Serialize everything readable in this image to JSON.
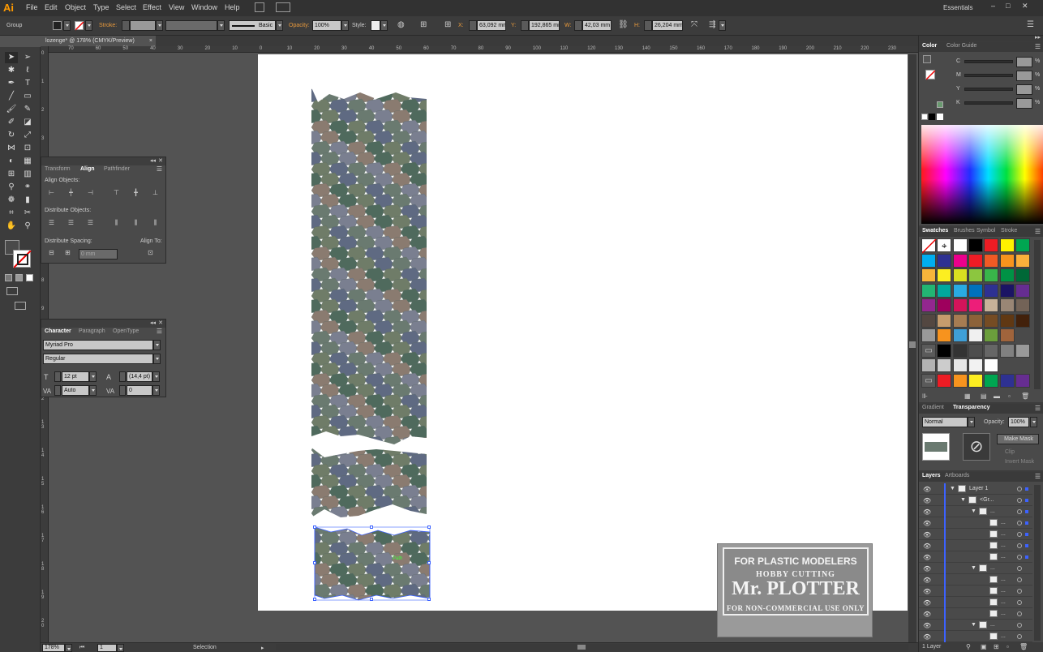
{
  "menubar": {
    "logo": "Ai",
    "items": [
      "File",
      "Edit",
      "Object",
      "Type",
      "Select",
      "Effect",
      "View",
      "Window",
      "Help"
    ],
    "workspace": "Essentials"
  },
  "control": {
    "selection_type": "Group",
    "stroke_label": "Stroke:",
    "brush": "Basic",
    "opacity_label": "Opacity:",
    "opacity": "100%",
    "style_label": "Style:",
    "x_label": "X:",
    "x": "63,092 mm",
    "y_label": "Y:",
    "y": "192,865 mm",
    "w_label": "W:",
    "w": "42,03 mm",
    "h_label": "H:",
    "h": "26,204 mm"
  },
  "document": {
    "tab": "lozenge* @ 178% (CMYK/Preview)",
    "close": "×"
  },
  "ruler": {
    "top_ticks": [
      "70",
      "60",
      "50",
      "40",
      "30",
      "20",
      "10",
      "0",
      "10",
      "20",
      "30",
      "40",
      "50",
      "60",
      "70",
      "80",
      "90",
      "100",
      "110",
      "120",
      "130",
      "140",
      "150",
      "160",
      "170",
      "180",
      "190",
      "200",
      "210",
      "220",
      "230"
    ],
    "left_ticks": [
      "0",
      "1",
      "2",
      "3",
      "4",
      "5",
      "6",
      "7",
      "8",
      "9",
      "10",
      "11",
      "12",
      "13",
      "14",
      "15",
      "16",
      "17",
      "18",
      "19",
      "20"
    ]
  },
  "align_panel": {
    "tabs": [
      "Transform",
      "Align",
      "Pathfinder"
    ],
    "align_objects": "Align Objects:",
    "distribute_objects": "Distribute Objects:",
    "distribute_spacing": "Distribute Spacing:",
    "align_to": "Align To:",
    "spacing_value": "0 mm"
  },
  "character_panel": {
    "tabs": [
      "Character",
      "Paragraph",
      "OpenType"
    ],
    "font": "Myriad Pro",
    "style": "Regular",
    "size": "12 pt",
    "leading": "(14,4 pt)",
    "kerning": "Auto",
    "tracking": "0"
  },
  "color_panel": {
    "tabs": [
      "Color",
      "Color Guide"
    ],
    "channels": [
      {
        "label": "C",
        "unit": "%"
      },
      {
        "label": "M",
        "unit": "%"
      },
      {
        "label": "Y",
        "unit": "%"
      },
      {
        "label": "K",
        "unit": "%"
      }
    ]
  },
  "swatches_panel": {
    "tabs": [
      "Swatches",
      "Brushes",
      "Symbol",
      "Stroke"
    ],
    "rows": [
      [
        "none",
        "register",
        "#ffffff",
        "#000000",
        "#ed1c24",
        "#fff200",
        "#00a651"
      ],
      [
        "#00aeef",
        "#2e3192",
        "#ec008c",
        "#ee1c25",
        "#f15a24",
        "#f7941d",
        "#fbb03b"
      ],
      [
        "#f7b53b",
        "#fcee21",
        "#d9e021",
        "#8cc63f",
        "#39b54a",
        "#009245",
        "#006837"
      ],
      [
        "#22b573",
        "#00a99d",
        "#29abe2",
        "#0071bc",
        "#2e3192",
        "#1b1464",
        "#662d91"
      ],
      [
        "#93278f",
        "#9e005d",
        "#d4145a",
        "#ed1e79",
        "#c7b299",
        "#998675",
        "#736357"
      ],
      [
        "#534741",
        "#c69c6d",
        "#a67c52",
        "#8c6239",
        "#754c24",
        "#603813",
        "#42210b"
      ],
      [
        "#999999",
        "#f7931e",
        "#3f9fd6",
        "#f0f0f0",
        "#6b9e3c",
        "#a0643c",
        ""
      ],
      [
        "folder",
        "#000000",
        "#333333",
        "#4d4d4d",
        "#666666",
        "#808080",
        "#999999"
      ],
      [
        "#b3b3b3",
        "#cccccc",
        "#e6e6e6",
        "#f2f2f2",
        "#ffffff",
        "",
        ""
      ],
      [
        "folder",
        "#ed1c24",
        "#f7931e",
        "#fcee21",
        "#00a651",
        "#2e3192",
        "#662d91"
      ]
    ]
  },
  "transparency_panel": {
    "tabs": [
      "Gradient",
      "Transparency"
    ],
    "blend_mode": "Normal",
    "opacity_label": "Opacity:",
    "opacity": "100%",
    "make_mask": "Make Mask",
    "clip": "Clip",
    "invert_mask": "Invert Mask"
  },
  "layers_panel": {
    "tabs": [
      "Layers",
      "Artboards"
    ],
    "rows": [
      {
        "name": "Layer 1",
        "indent": 0
      },
      {
        "name": "<Gr...",
        "indent": 1
      },
      {
        "name": "...",
        "indent": 2
      },
      {
        "name": "...",
        "indent": 3
      },
      {
        "name": "...",
        "indent": 3
      },
      {
        "name": "...",
        "indent": 3
      },
      {
        "name": "...",
        "indent": 3
      },
      {
        "name": "...",
        "indent": 2
      },
      {
        "name": "...",
        "indent": 3
      },
      {
        "name": "...",
        "indent": 3
      },
      {
        "name": "...",
        "indent": 3
      },
      {
        "name": "...",
        "indent": 3
      },
      {
        "name": "...",
        "indent": 2
      },
      {
        "name": "...",
        "indent": 3
      }
    ],
    "count": "1 Layer"
  },
  "status": {
    "zoom": "178%",
    "artboard": "1",
    "tool": "Selection"
  },
  "canvas": {
    "selection_label": "Path",
    "palette": [
      "#6a7a70",
      "#7a7f90",
      "#8a7b70",
      "#4f6a5d",
      "#6f7c68",
      "#5f6a82"
    ]
  },
  "watermark": {
    "line1": "FOR PLASTIC MODELERS",
    "line2": "HOBBY CUTTING",
    "line3": "Mr. PLOTTER",
    "line4": "FOR NON-COMMERCIAL USE ONLY"
  }
}
